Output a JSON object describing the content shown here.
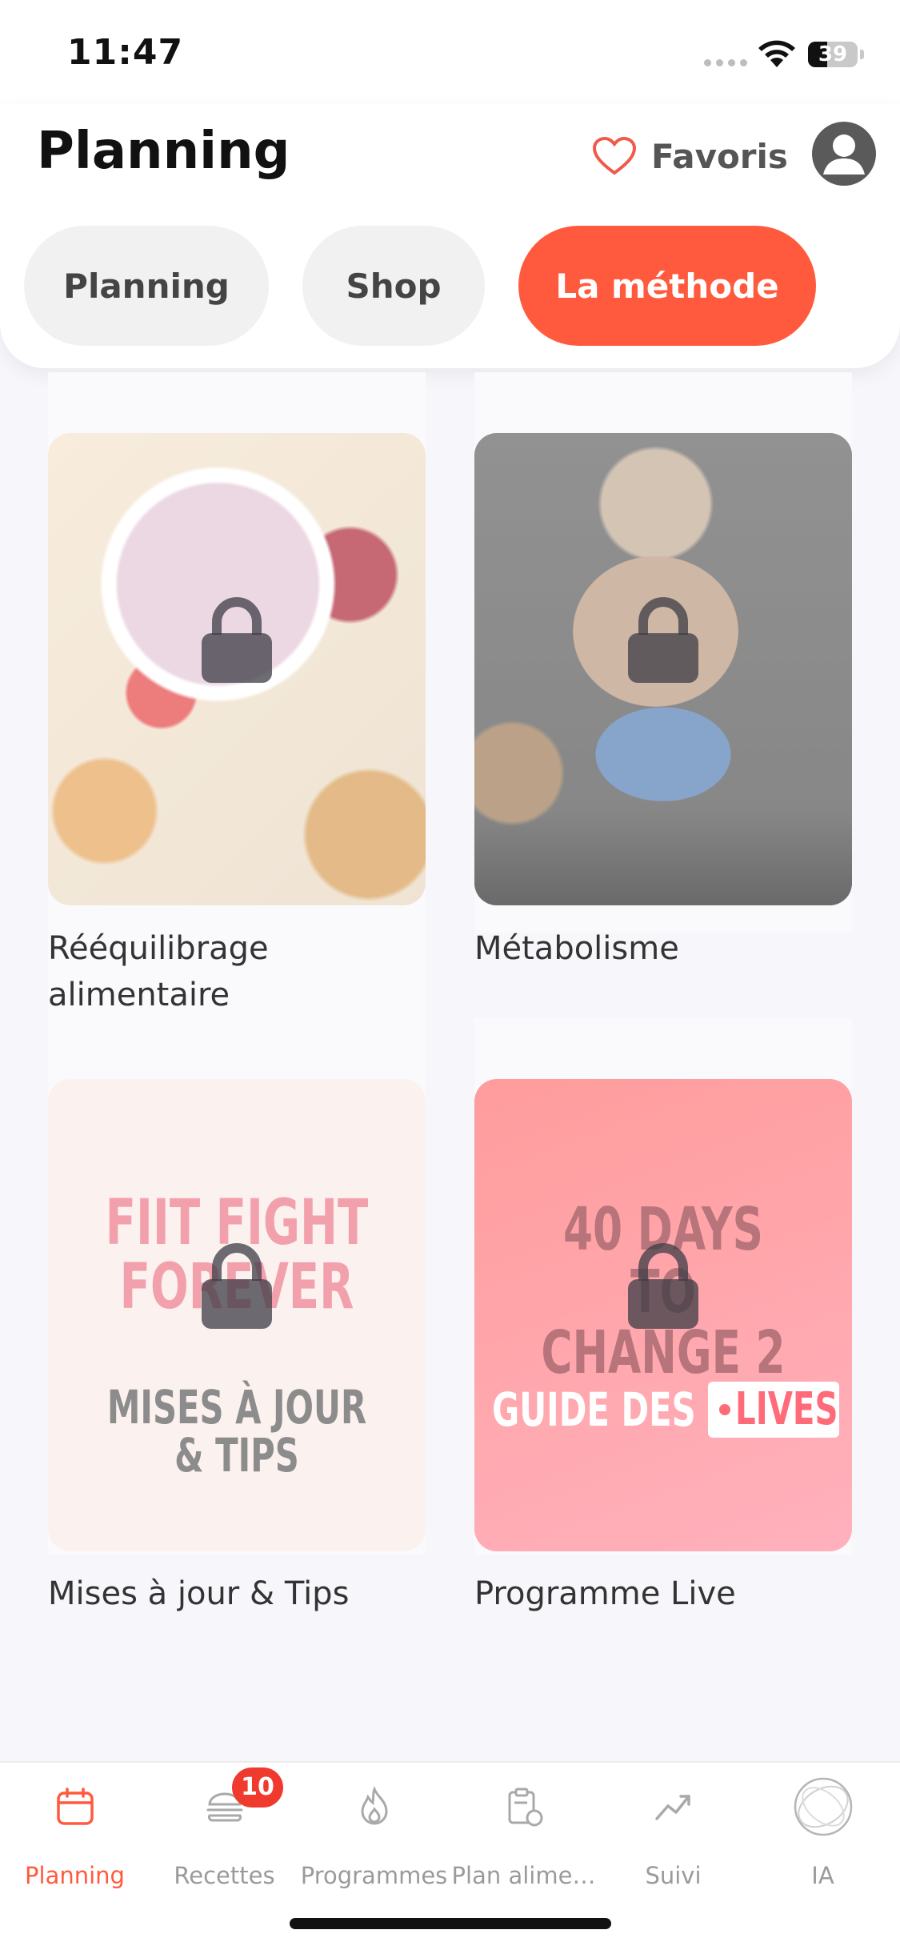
{
  "status": {
    "time": "11:47",
    "battery": "39"
  },
  "header": {
    "title": "Planning",
    "favorites_label": "Favoris"
  },
  "tabs": [
    {
      "label": "Planning",
      "active": false
    },
    {
      "label": "Shop",
      "active": false
    },
    {
      "label": "La méthode",
      "active": true
    }
  ],
  "cards": [
    {
      "label": "Rééquilibrage alimentaire",
      "locked": true
    },
    {
      "label": "Métabolisme",
      "locked": true
    },
    {
      "label": "Mises à jour & Tips",
      "locked": true,
      "cover_lines": [
        "FIIT FIGHT",
        "FOREVER",
        "MISES À JOUR & TIPS"
      ]
    },
    {
      "label": "Programme Live",
      "locked": true,
      "cover_lines": [
        "40 DAYS",
        "TO CHANGE 2",
        "GUIDE DES",
        "LIVES"
      ]
    }
  ],
  "tabbar": {
    "items": [
      {
        "label": "Planning",
        "icon": "calendar-icon",
        "active": true
      },
      {
        "label": "Recettes",
        "icon": "burger-icon",
        "active": false
      },
      {
        "label": "Programmes",
        "icon": "flame-icon",
        "active": false
      },
      {
        "label": "Plan alime…",
        "icon": "clipboard-apple-icon",
        "active": false
      },
      {
        "label": "Suivi",
        "icon": "trend-icon",
        "active": false
      },
      {
        "label": "IA",
        "icon": "ai-orb-icon",
        "active": false
      }
    ],
    "recettes_badge": "10"
  },
  "colors": {
    "accent": "#ff5a3d",
    "badge": "#f03a2e"
  }
}
